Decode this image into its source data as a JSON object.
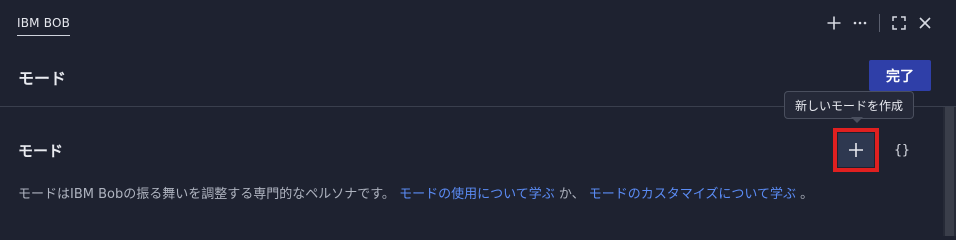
{
  "tab": {
    "label": "IBM BOB"
  },
  "tab_actions": {
    "new_icon": "plus-icon",
    "more_icon": "ellipsis-icon",
    "fullscreen_icon": "fullscreen-icon",
    "close_icon": "close-icon"
  },
  "header": {
    "title": "モード",
    "done_label": "完了"
  },
  "section": {
    "title": "モード",
    "add_tooltip": "新しいモードを作成",
    "json_label": "{}"
  },
  "description": {
    "text_before": "モードはIBM Bobの振る舞いを調整する専門的なペルソナです。",
    "link1": "モードの使用について学ぶ",
    "text_middle": "か、",
    "link2": "モードのカスタマイズについて学ぶ",
    "text_after": "。"
  },
  "colors": {
    "background": "#1e2230",
    "primary_button": "#2f3fa8",
    "link": "#5b8cf5",
    "highlight": "#e02020"
  }
}
